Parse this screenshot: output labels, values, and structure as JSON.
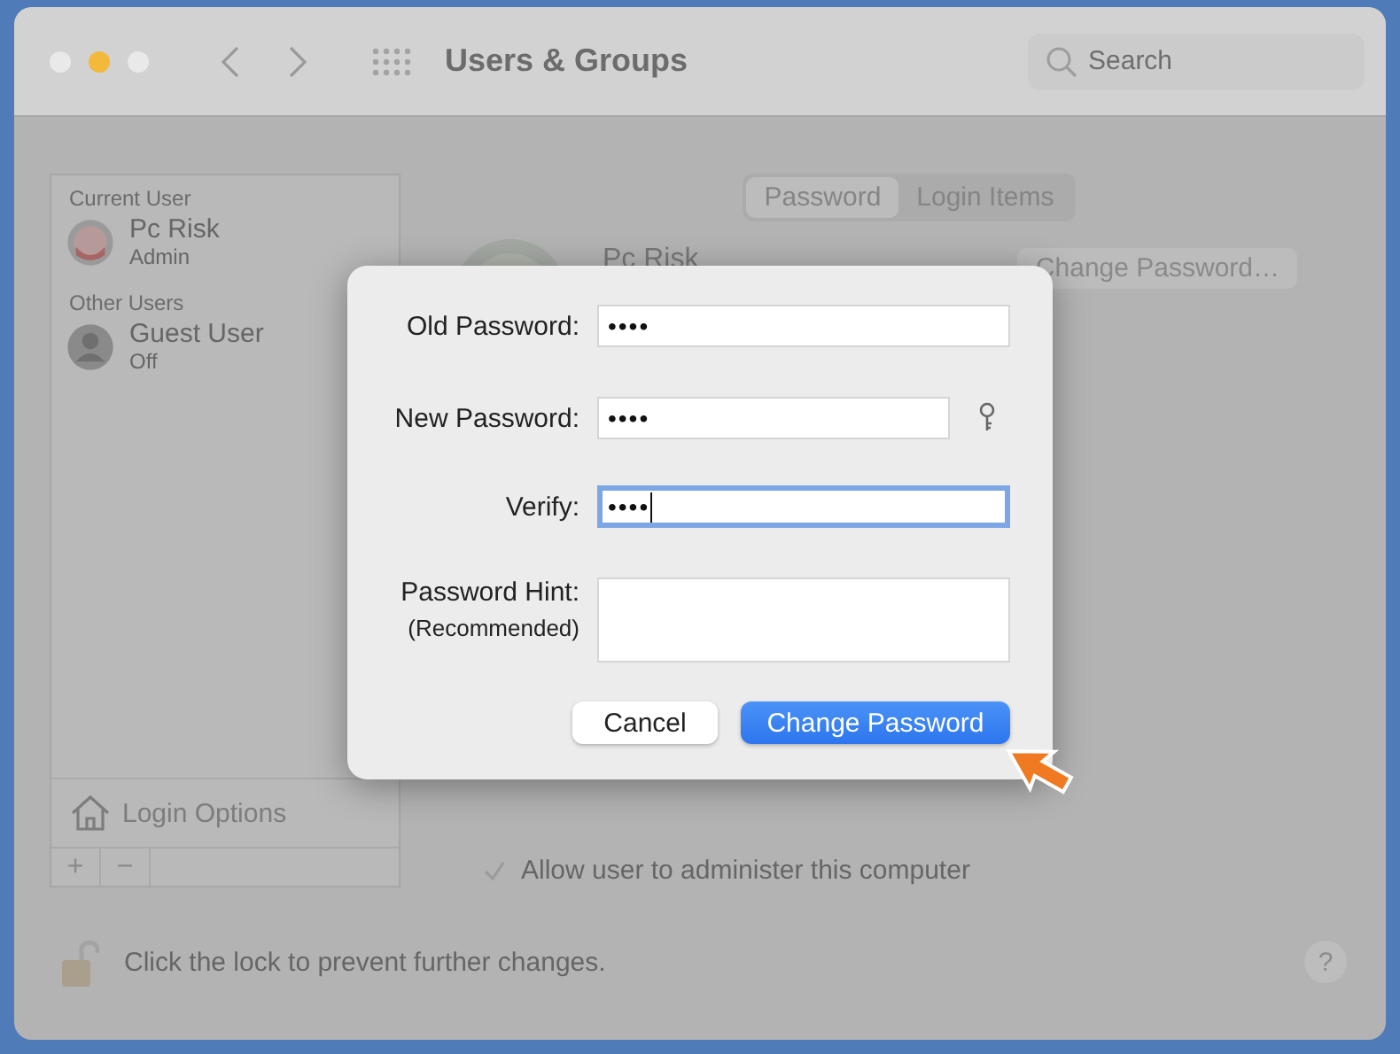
{
  "window": {
    "title": "Users & Groups",
    "search": {
      "placeholder": "Search"
    }
  },
  "tabs": [
    {
      "label": "Password",
      "selected": true
    },
    {
      "label": "Login Items",
      "selected": false
    }
  ],
  "sidebar": {
    "sections": [
      {
        "heading": "Current User",
        "users": [
          {
            "name": "Pc Risk",
            "role": "Admin",
            "kind": "photo"
          }
        ]
      },
      {
        "heading": "Other Users",
        "users": [
          {
            "name": "Guest User",
            "role": "Off",
            "kind": "silhouette"
          }
        ]
      }
    ],
    "login_options": "Login Options",
    "add": "+",
    "remove": "−"
  },
  "user": {
    "name": "Pc Risk",
    "change_button": "Change Password…"
  },
  "admin_option": {
    "label": "Allow user to administer this computer",
    "checked": true
  },
  "lock": {
    "text": "Click the lock to prevent further changes.",
    "locked": false
  },
  "help": "?",
  "dialog": {
    "fields": [
      {
        "label": "Old Password:",
        "value": "••••",
        "kind": "password",
        "focused": false,
        "assistant": false
      },
      {
        "label": "New Password:",
        "value": "••••",
        "kind": "password",
        "focused": false,
        "assistant": true
      },
      {
        "label": "Verify:",
        "value": "••••",
        "kind": "password",
        "focused": true,
        "assistant": false
      },
      {
        "label": "Password Hint:",
        "sublabel": "(Recommended)",
        "kind": "textarea",
        "focused": false,
        "assistant": false
      }
    ],
    "buttons": [
      {
        "label": "Cancel",
        "default": false
      },
      {
        "label": "Change Password",
        "default": true
      }
    ]
  }
}
